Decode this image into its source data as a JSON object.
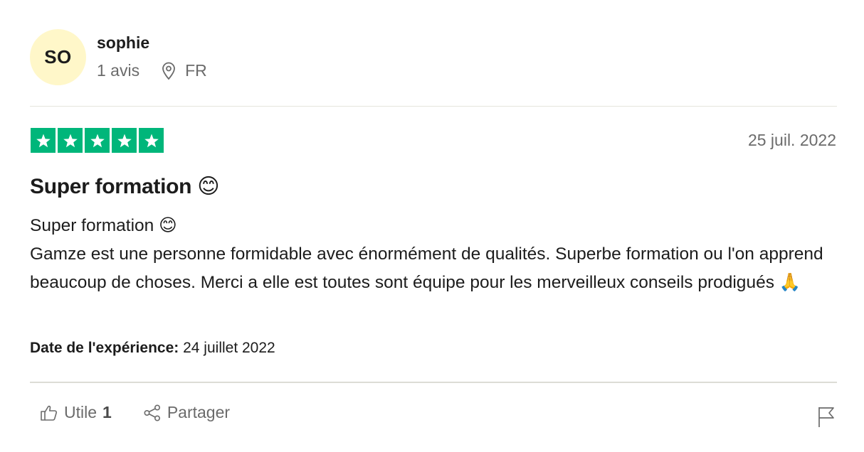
{
  "consumer": {
    "initials": "SO",
    "name": "sophie",
    "review_count": "1 avis",
    "location": "FR",
    "avatar_color": "#fff7c9"
  },
  "review": {
    "rating": 5,
    "rating_color": "#00b67a",
    "date": "25 juil. 2022",
    "title": "Super formation 😊",
    "body": "Super formation 😊\nGamze est une personne formidable avec énormément de qualités. Superbe formation ou l'on apprend beaucoup de choses. Merci a elle est toutes sont équipe pour les merveilleux conseils prodigués 🙏",
    "experience_label": "Date de l'expérience:",
    "experience_date": "24 juillet 2022"
  },
  "actions": {
    "useful_label": "Utile",
    "useful_count": "1",
    "share_label": "Partager",
    "icons": [
      "thumbs-up-icon",
      "share-icon",
      "flag-icon",
      "location-pin-icon",
      "star-icon"
    ]
  }
}
